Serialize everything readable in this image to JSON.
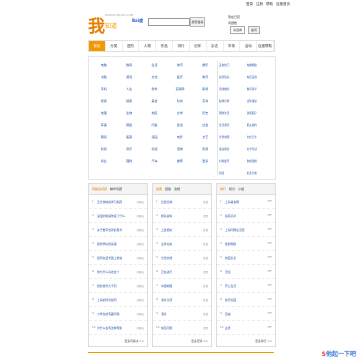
{
  "toplinks": [
    "登录",
    "注册",
    "帮助",
    "百度首页"
  ],
  "logo": {
    "char": "我",
    "sub": "知道",
    "url": "ZHIDAO.BAIDU.COM"
  },
  "search": {
    "brand": "Bai度",
    "button": "搜索答案"
  },
  "rightinfo": {
    "line1": "现在已有",
    "line2": "问题数",
    "select": "请选择",
    "button": "提问"
  },
  "nav": [
    "首页",
    "分类",
    "进阶",
    "人物",
    "作品",
    "排行",
    "纪年",
    "杂志",
    "市场",
    "活动",
    "百度帮助"
  ],
  "categories": [
    "电脑",
    "数码",
    "生活",
    "体育",
    "娱乐",
    "书籍",
    "游戏",
    "文化",
    "医疗",
    "教育",
    "手机",
    "人生",
    "软件",
    "互联网",
    "职场",
    "旅游",
    "健康",
    "美食",
    "时尚",
    "高考",
    "地理",
    "生物",
    "地区",
    "文学",
    "历史",
    "军事",
    "网络",
    "问答",
    "政治",
    "社会",
    "期货",
    "股票",
    "漫画",
    "电影",
    "文艺",
    "新闻",
    "音乐",
    "动漫",
    "宠物",
    "影视",
    "商业",
    "理财",
    "汽车",
    "推荐",
    "更多"
  ],
  "catside": [
    "美食热门",
    "电脑网络",
    "彩票知识",
    "电影美容",
    "游戏数码",
    "教育科学",
    "职场世界",
    "法律康复",
    "理财生活",
    "健康医疗",
    "生活课堂",
    "相关资料",
    "世界地理",
    "文化艺术",
    "运动健身",
    "文学考试",
    "时尚娱乐",
    "象棋围棋",
    "新闻",
    "更多分类"
  ],
  "panels": [
    {
      "tabs": [
        "待解决问题",
        "精华问题"
      ],
      "rows": [
        {
          "num": "1.",
          "title": "五分钟快速学习指南",
          "meta": "已解决"
        },
        {
          "num": "2.",
          "title": "浪漫的寄语你说了什么",
          "meta": "已解决"
        },
        {
          "num": "3.",
          "title": "关于数字世界的思考",
          "meta": "已解决"
        },
        {
          "num": "4.",
          "title": "我想学好的英语",
          "meta": "已解决"
        },
        {
          "num": "5.",
          "title": "如何在漫长路上前进",
          "meta": "已解决"
        },
        {
          "num": "6.",
          "title": "你为什么喜欢这个",
          "meta": "已解决"
        },
        {
          "num": "7.",
          "title": "我的世界大不同",
          "meta": "已解决"
        },
        {
          "num": "8.",
          "title": "上海的风景如何",
          "meta": "已解决"
        },
        {
          "num": "9.",
          "title": "小学生的有趣问题",
          "meta": "已解决"
        },
        {
          "num": "10.",
          "title": "为什么会有这种现象",
          "meta": "已解决"
        }
      ],
      "more": "更多待解决 >>"
    },
    {
      "tabs": [
        "指南",
        "经验",
        "法规"
      ],
      "rows": [
        {
          "num": "1.",
          "title": "比较高效",
          "meta": "查看"
        },
        {
          "num": "2.",
          "title": "相关资料",
          "meta": "查看"
        },
        {
          "num": "3.",
          "title": "上链相关",
          "meta": "查看"
        },
        {
          "num": "4.",
          "title": "业界动态",
          "meta": "查看"
        },
        {
          "num": "5.",
          "title": "全部文档",
          "meta": "查看"
        },
        {
          "num": "6.",
          "title": "正在进行",
          "meta": "查看"
        },
        {
          "num": "7.",
          "title": "中国地图",
          "meta": "查看"
        },
        {
          "num": "8.",
          "title": "消息全部",
          "meta": "查看"
        },
        {
          "num": "9.",
          "title": "消息",
          "meta": "查看"
        },
        {
          "num": "10.",
          "title": "常见问题",
          "meta": "查看"
        }
      ],
      "more": "更多经验 >>"
    },
    {
      "tabs": [
        "排行",
        "积分",
        "小组"
      ],
      "rows": [
        {
          "num": "1.",
          "title": "上海美食网",
          "meta": "CEF"
        },
        {
          "num": "2.",
          "title": "指南高手",
          "meta": "CEF"
        },
        {
          "num": "3.",
          "title": "上海同网生活结",
          "meta": "CEF"
        },
        {
          "num": "4.",
          "title": "我的网络",
          "meta": "CEF"
        },
        {
          "num": "5.",
          "title": "校园信息",
          "meta": "CEF"
        },
        {
          "num": "6.",
          "title": "天使",
          "meta": "CEF"
        },
        {
          "num": "7.",
          "title": "开心生活",
          "meta": "CEF"
        },
        {
          "num": "8.",
          "title": "快乐家园",
          "meta": "CEF"
        },
        {
          "num": "9.",
          "title": "自由",
          "meta": "CEF"
        },
        {
          "num": "10.",
          "title": "业界",
          "meta": "CEF"
        }
      ],
      "more": "更多排行 >>"
    }
  ],
  "watermark": {
    "prefix": "S",
    "rest": "他起一下吧"
  }
}
